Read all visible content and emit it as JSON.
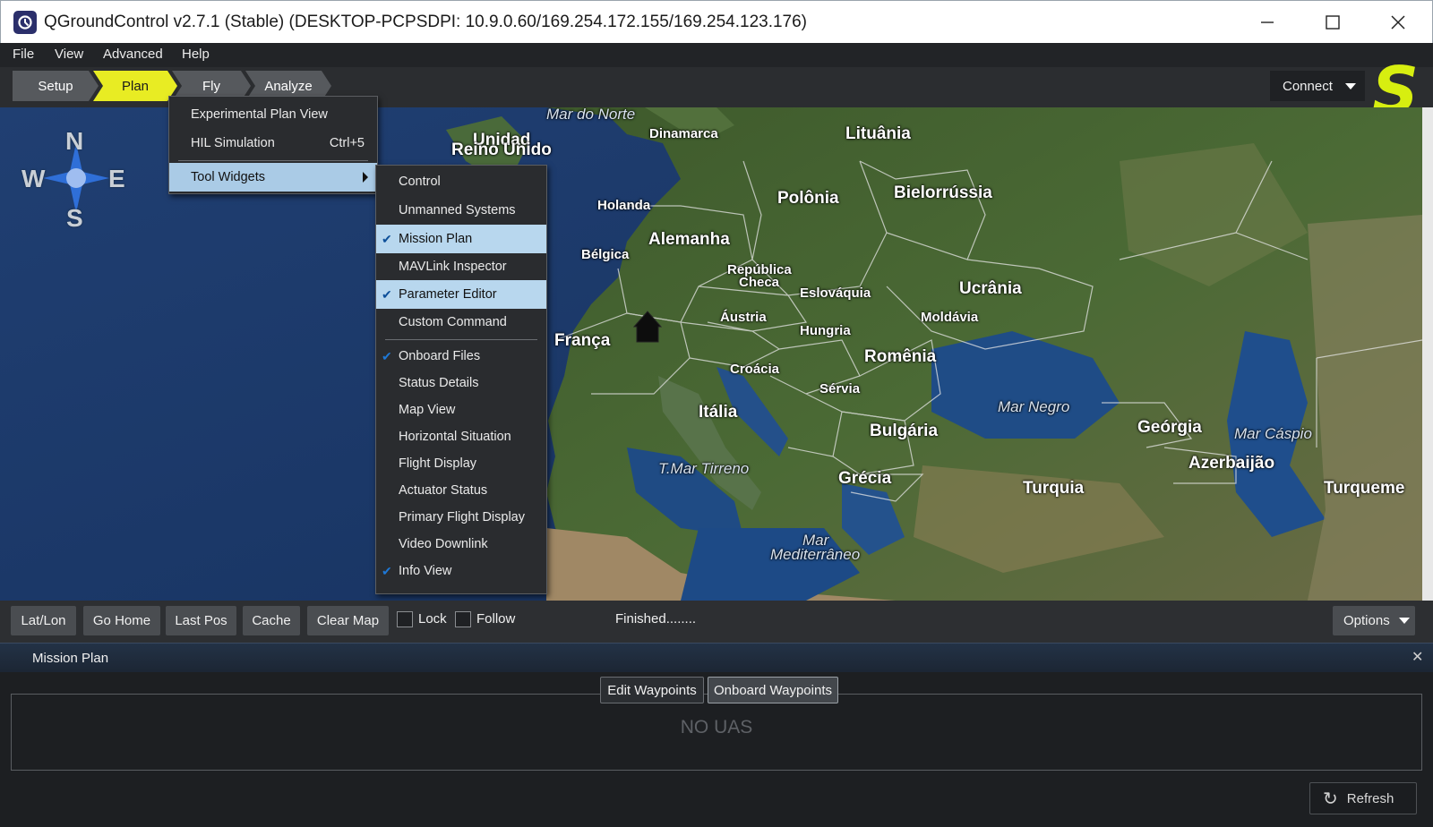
{
  "window": {
    "title": "QGroundControl v2.7.1 (Stable) (DESKTOP-PCPSDPI: 10.9.0.60/169.254.172.155/169.254.123.176)",
    "minimize_icon": "minimize-icon",
    "maximize_icon": "maximize-icon",
    "close_icon": "close-icon"
  },
  "menubar": {
    "items": [
      {
        "label": "File"
      },
      {
        "label": "View"
      },
      {
        "label": "Advanced"
      },
      {
        "label": "Help"
      }
    ]
  },
  "toolbar": {
    "tabs": [
      {
        "label": "Setup"
      },
      {
        "label": "Plan",
        "active": true
      },
      {
        "label": "Fly"
      },
      {
        "label": "Analyze"
      }
    ],
    "connect_label": "Connect",
    "brand_logo": "S",
    "accent_color": "#e8ec23"
  },
  "advanced_menu": {
    "items": [
      {
        "label": "Experimental Plan View",
        "shortcut": ""
      },
      {
        "label": "HIL Simulation",
        "shortcut": "Ctrl+5"
      },
      {
        "label": "Tool Widgets",
        "submenu": true,
        "highlighted": true
      }
    ]
  },
  "tool_widgets_menu": {
    "items": [
      {
        "label": "Control",
        "checked": false
      },
      {
        "label": "Unmanned Systems",
        "checked": false
      },
      {
        "label": "Mission Plan",
        "checked": true,
        "highlighted": true
      },
      {
        "label": "MAVLink Inspector",
        "checked": false
      },
      {
        "label": "Parameter Editor",
        "checked": true,
        "highlighted": true
      },
      {
        "label": "Custom Command",
        "checked": false
      },
      {
        "label": "Onboard Files",
        "checked": true
      },
      {
        "label": "Status Details",
        "checked": false
      },
      {
        "label": "Map View",
        "checked": false
      },
      {
        "label": "Horizontal Situation",
        "checked": false
      },
      {
        "label": "Flight Display",
        "checked": false
      },
      {
        "label": "Actuator Status",
        "checked": false
      },
      {
        "label": "Primary Flight Display",
        "checked": false
      },
      {
        "label": "Video Downlink",
        "checked": false
      },
      {
        "label": "Info View",
        "checked": true
      }
    ],
    "check_glyph": "✔"
  },
  "map": {
    "compass": {
      "n": "N",
      "s": "S",
      "e": "E",
      "w": "W"
    },
    "labels": {
      "mar_do_norte": "Mar do Norte",
      "reino_unido_top": "Unidad",
      "reino_unido": "Reino Unido",
      "dinamarca": "Dinamarca",
      "lituania": "Lituânia",
      "polonia": "Polônia",
      "bielorrussia": "Bielorrússia",
      "holanda": "Holanda",
      "alemanha": "Alemanha",
      "belgica": "Bélgica",
      "republica_checa_1": "República",
      "republica_checa_2": "Checa",
      "eslovaquia": "Eslováquia",
      "ucrania": "Ucrânia",
      "austria": "Áustria",
      "moldavia": "Moldávia",
      "franca": "França",
      "hungria": "Hungria",
      "romenia": "Romênia",
      "croacia": "Croácia",
      "servia": "Sérvia",
      "mar_negro": "Mar Negro",
      "italia": "Itália",
      "bulgaria": "Bulgária",
      "georgia": "Geórgia",
      "mar_caspio": "Mar Cáspio",
      "azerbaijao": "Azerbaijão",
      "mar_tirreno": "T.Mar Tirreno",
      "grecia": "Grécia",
      "turquia": "Turquia",
      "turquemenistao": "Turqueme",
      "mediterraneo_1": "Mar",
      "mediterraneo_2": "Mediterrâneo"
    },
    "home_icon": "home-marker-icon"
  },
  "map_toolbar": {
    "buttons": [
      {
        "label": "Lat/Lon"
      },
      {
        "label": "Go Home"
      },
      {
        "label": "Last Pos"
      },
      {
        "label": "Cache"
      },
      {
        "label": "Clear Map"
      }
    ],
    "lock_label": "Lock",
    "follow_label": "Follow",
    "lock_checked": false,
    "follow_checked": false,
    "status": "Finished........",
    "options_label": "Options"
  },
  "mission_plan": {
    "title": "Mission Plan",
    "close_glyph": "✕",
    "tabs": [
      {
        "label": "Edit Waypoints",
        "active": false
      },
      {
        "label": "Onboard Waypoints",
        "active": true
      }
    ],
    "empty_message": "NO UAS",
    "refresh_label": "Refresh",
    "refresh_icon": "refresh-icon"
  }
}
